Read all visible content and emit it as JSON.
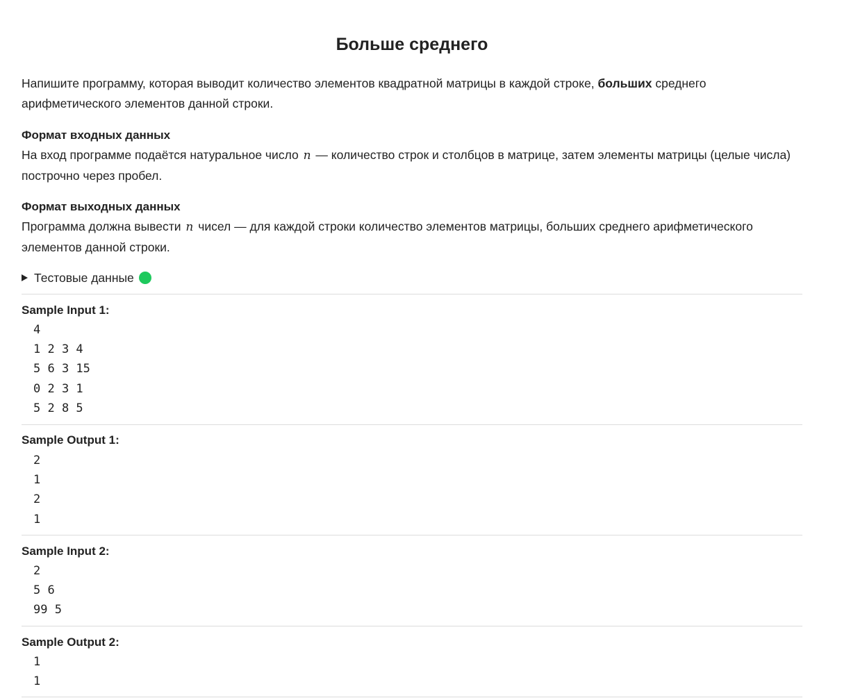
{
  "title": "Больше среднего",
  "intro": {
    "before": "Напишите программу, которая выводит количество элементов квадратной матрицы в каждой строке, ",
    "bold": "больших",
    "after": " среднего арифметического элементов данной строки."
  },
  "input_format": {
    "heading": "Формат входных данных",
    "before": "На вход программе подаётся натуральное число ",
    "var": "n",
    "after": " — количество строк и столбцов в матрице, затем элементы матрицы (целые числа) построчно через пробел."
  },
  "output_format": {
    "heading": "Формат выходных данных",
    "before": "Программа должна вывести ",
    "var": "n",
    "after": " чисел — для каждой строки количество элементов матрицы, больших среднего арифметического элементов данной строки."
  },
  "tests": {
    "label": "Тестовые данные",
    "status_color": "#1ec95d",
    "icon": "triangle-right-icon"
  },
  "samples": [
    {
      "label": "Sample Input 1:",
      "text": "4\n1 2 3 4\n5 6 3 15\n0 2 3 1\n5 2 8 5"
    },
    {
      "label": "Sample Output 1:",
      "text": "2\n1\n2\n1"
    },
    {
      "label": "Sample Input 2:",
      "text": "2\n5 6\n99 5"
    },
    {
      "label": "Sample Output 2:",
      "text": "1\n1"
    }
  ]
}
